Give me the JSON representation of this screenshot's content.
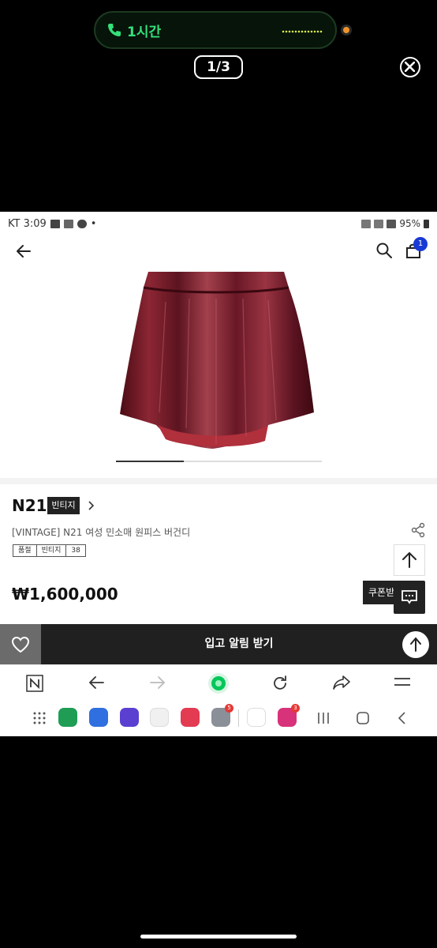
{
  "overlay": {
    "call_duration": "1시간",
    "page_indicator": "1/3",
    "close_label": "close"
  },
  "status_bar": {
    "carrier_time": "KT 3:09",
    "battery": "95%"
  },
  "header": {
    "cart_count": "1"
  },
  "gallery": {
    "progress_fraction": 0.33
  },
  "product": {
    "brand": "N21",
    "brand_tag": "빈티지",
    "title": "[VINTAGE] N21 여성 민소매 원피스 버건디",
    "chips": [
      "품절",
      "빈티지",
      "38"
    ],
    "price": "₩1,600,000",
    "coupon_label": "쿠폰받"
  },
  "bottom_bar": {
    "cta_label": "입고 알림 받기"
  },
  "nav_apps": [
    {
      "name": "phone-app-icon",
      "color": "#1f9d55",
      "badge": ""
    },
    {
      "name": "messages-app-icon",
      "color": "#2f6fe0",
      "badge": ""
    },
    {
      "name": "internet-app-icon",
      "color": "#5b3fd0",
      "badge": ""
    },
    {
      "name": "play-store-icon",
      "color": "#f0f0f0",
      "badge": ""
    },
    {
      "name": "camera-app-icon",
      "color": "#e23b52",
      "badge": ""
    },
    {
      "name": "folder-app-icon",
      "color": "#8a8f98",
      "badge": "5"
    },
    {
      "name": "carrot-app-icon",
      "color": "#ffffff",
      "badge": ""
    },
    {
      "name": "instagram-app-icon",
      "color": "#d8327a",
      "badge": "3"
    }
  ]
}
